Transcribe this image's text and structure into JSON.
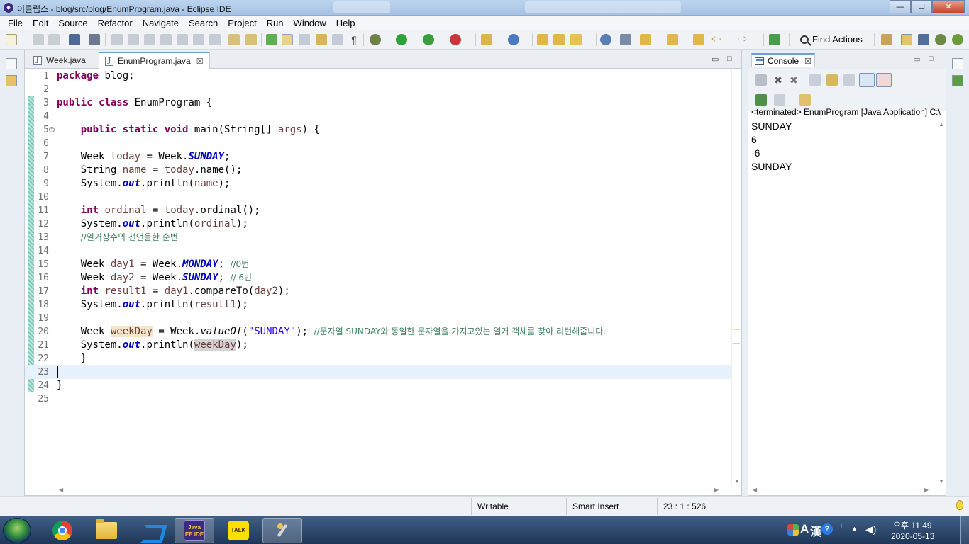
{
  "window": {
    "title": "이클립스 - blog/src/blog/EnumProgram.java - Eclipse IDE",
    "min": "—",
    "max": "☐",
    "close": "✕"
  },
  "menu": [
    "File",
    "Edit",
    "Source",
    "Refactor",
    "Navigate",
    "Search",
    "Project",
    "Run",
    "Window",
    "Help"
  ],
  "toolbar": {
    "find_actions": "Find Actions"
  },
  "editor": {
    "tabs": [
      {
        "label": "Week.java",
        "active": false
      },
      {
        "label": "EnumProgram.java",
        "active": true
      }
    ],
    "close_glyph": "☒",
    "current_line": 23,
    "lines": [
      {
        "n": "1"
      },
      {
        "n": "2"
      },
      {
        "n": "3"
      },
      {
        "n": "4"
      },
      {
        "n": "5"
      },
      {
        "n": "6"
      },
      {
        "n": "7"
      },
      {
        "n": "8"
      },
      {
        "n": "9"
      },
      {
        "n": "10"
      },
      {
        "n": "11"
      },
      {
        "n": "12"
      },
      {
        "n": "13"
      },
      {
        "n": "14"
      },
      {
        "n": "15"
      },
      {
        "n": "16"
      },
      {
        "n": "17"
      },
      {
        "n": "18"
      },
      {
        "n": "19"
      },
      {
        "n": "20"
      },
      {
        "n": "21"
      },
      {
        "n": "22"
      },
      {
        "n": "23"
      },
      {
        "n": "24"
      },
      {
        "n": "25"
      }
    ],
    "code": {
      "l1_kw": "package",
      "l1_rest": " blog;",
      "l3_kw1": "public",
      "l3_kw2": "class",
      "l3_rest": " EnumProgram {",
      "l5_kw1": "public",
      "l5_kw2": "static",
      "l5_kw3": "void",
      "l5_rest": " main(String[] ",
      "l5_var": "args",
      "l5_end": ") {",
      "l7_a": "Week ",
      "l7_var": "today",
      "l7_b": " = Week.",
      "l7_const": "SUNDAY",
      "l7_c": ";",
      "l8_a": "String ",
      "l8_var": "name",
      "l8_b": " = ",
      "l8_var2": "today",
      "l8_c": ".name();",
      "l9_a": "System.",
      "l9_out": "out",
      "l9_b": ".println(",
      "l9_var": "name",
      "l9_c": ");",
      "l11_kw": "int",
      "l11_var": "ordinal",
      "l11_b": " = ",
      "l11_var2": "today",
      "l11_c": ".ordinal();",
      "l12_a": "System.",
      "l12_out": "out",
      "l12_b": ".println(",
      "l12_var": "ordinal",
      "l12_c": ");",
      "l13_cmt": "//열거상수의 선언을한 순번",
      "l15_a": "Week ",
      "l15_var": "day1",
      "l15_b": " = Week.",
      "l15_const": "MONDAY",
      "l15_c": "; ",
      "l15_cmt": "//0번",
      "l16_a": "Week ",
      "l16_var": "day2",
      "l16_b": " = Week.",
      "l16_const": "SUNDAY",
      "l16_c": "; ",
      "l16_cmt": "// 6번",
      "l17_kw": "int",
      "l17_var": "result1",
      "l17_b": " = ",
      "l17_var2": "day1",
      "l17_c": ".compareTo(",
      "l17_var3": "day2",
      "l17_d": ");",
      "l18_a": "System.",
      "l18_out": "out",
      "l18_b": ".println(",
      "l18_var": "result1",
      "l18_c": ");",
      "l20_a": "Week ",
      "l20_var": "weekDay",
      "l20_b": " = Week.",
      "l20_method": "valueOf",
      "l20_c": "(",
      "l20_str": "\"SUNDAY\"",
      "l20_d": "); ",
      "l20_cmt": "//문자열 SUNDAY와 동일한 문자열을 가지고있는 열거 객체를 찾아 리턴해줍니다.",
      "l21_a": "System.",
      "l21_out": "out",
      "l21_b": ".println(",
      "l21_var": "weekDay",
      "l21_c": ");",
      "l22": "}",
      "l24": "}"
    }
  },
  "console": {
    "tab_label": "Console",
    "close_glyph": "☒",
    "terminated": "<terminated> EnumProgram [Java Application] C:\\",
    "output": "SUNDAY\n6\n-6\nSUNDAY"
  },
  "status": {
    "writable": "Writable",
    "insert_mode": "Smart Insert",
    "position": "23 : 1 : 526"
  },
  "taskbar": {
    "eclipse_label": "Java EE IDE",
    "talk_label": "TALK",
    "ime_a": "A",
    "ime_han": "漢",
    "help": "?",
    "time": "오후 11:49",
    "date": "2020-05-13"
  }
}
